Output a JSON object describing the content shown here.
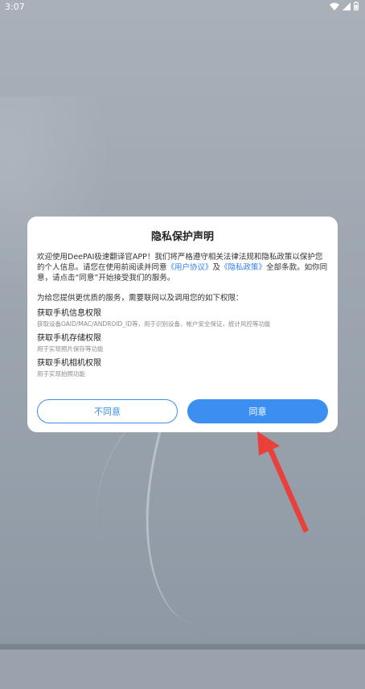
{
  "status_bar": {
    "time": "3:07",
    "icons": [
      "wifi-icon",
      "signal-icon",
      "battery-icon"
    ]
  },
  "dialog": {
    "title": "隐私保护声明",
    "intro_prefix": "欢迎使用DeePAI极速翻译官APP！我们将严格遵守相关法律法规和隐私政策以保护您的个人信息。请您在使用前阅读并同意",
    "user_agreement_link": "《用户协议》",
    "and_text": "及",
    "privacy_policy_link": "《隐私政策》",
    "intro_suffix": "全部条款。如你同意，请点击“同意”开始接受我们的服务。",
    "permissions_intro": "为给您提供更优质的服务，需要联网以及调用您的如下权限：",
    "permissions": [
      {
        "title": "获取手机信息权限",
        "desc": "获取设备OAID/MAC/ANDROID_ID等，用于识别设备、帐户安全保证，统计风控等功能"
      },
      {
        "title": "获取手机存储权限",
        "desc": "用于实现照片保存等功能"
      },
      {
        "title": "获取手机相机权限",
        "desc": "用于实现拍照功能"
      }
    ],
    "disagree_label": "不同意",
    "agree_label": "同意"
  },
  "colors": {
    "accent": "#3a8ff0",
    "link": "#2f80ed",
    "annotation_arrow": "#e8403a"
  }
}
